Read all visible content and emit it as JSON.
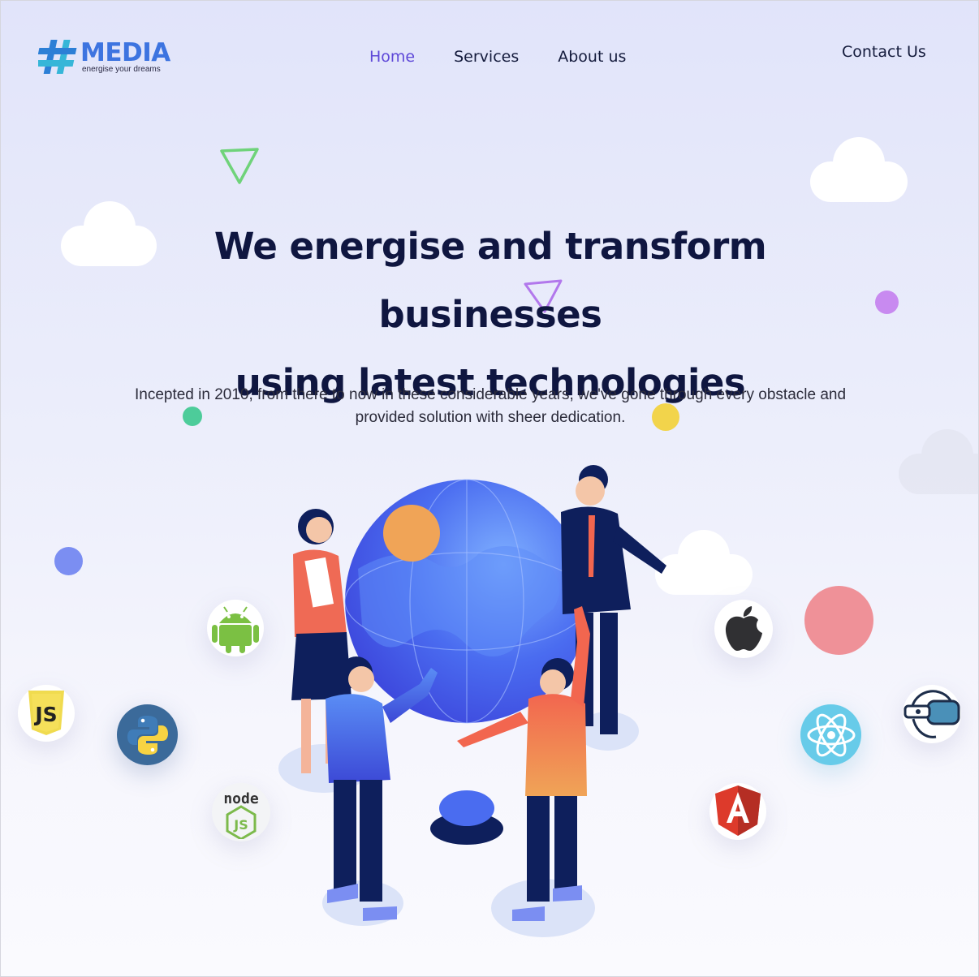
{
  "brand": {
    "name": "MEDIA",
    "tagline": "energise your dreams",
    "colors": {
      "primary": "#3d74e0",
      "mark_blue": "#2c7fd6",
      "mark_teal": "#36b6d8"
    }
  },
  "nav": {
    "items": [
      {
        "label": "Home",
        "active": true
      },
      {
        "label": "Services",
        "active": false
      },
      {
        "label": "About us",
        "active": false
      }
    ],
    "contact_label": "Contact Us",
    "active_color": "#5e48d8"
  },
  "hero": {
    "headline_line1": "We energise and transform businesses",
    "headline_line2": "using latest technologies",
    "description": "Incepted in 2010, from there to now in these considerable years, we've gone through every obstacle and provided solution with sheer dedication."
  },
  "illustration": {
    "subject": "team-around-globe",
    "colors": {
      "globe": "#4a6cf0",
      "navy": "#0e1f5c",
      "coral": "#ef6a55",
      "orange": "#f0a457"
    }
  },
  "tech_icons": [
    "android-icon",
    "javascript-icon",
    "python-icon",
    "nodejs-icon",
    "apple-icon",
    "react-icon",
    "angular-icon",
    "vr-headset-icon"
  ],
  "decor_colors": {
    "green": "#4dcc9a",
    "yellow": "#f2d44b",
    "purple": "#c88af0",
    "blue": "#7b8ef2",
    "pink": "#ef9198",
    "orange": "#f0a457"
  }
}
